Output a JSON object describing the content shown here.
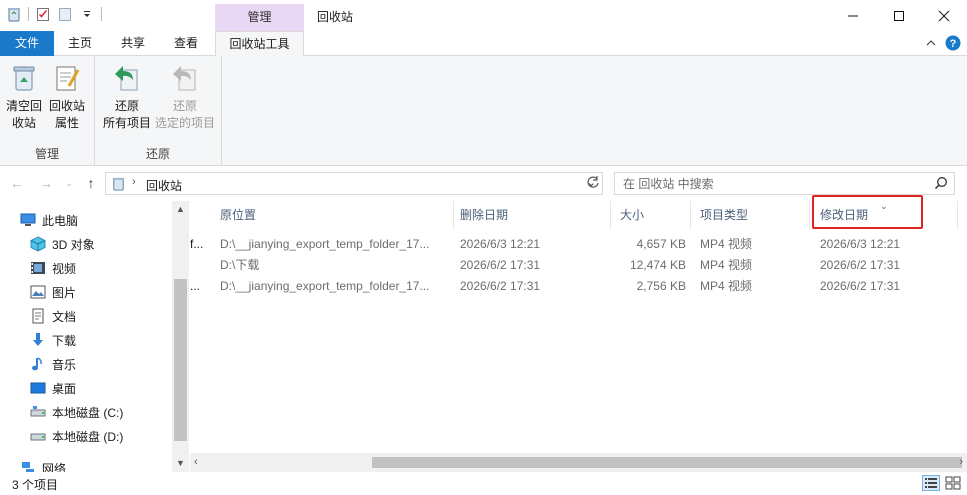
{
  "window": {
    "title": "回收站",
    "context_tab": "管理",
    "controls": [
      "minimize-icon",
      "maximize-icon",
      "close-icon"
    ]
  },
  "ribbon": {
    "tabs": [
      {
        "label": "文件",
        "name": "tab-file"
      },
      {
        "label": "主页",
        "name": "tab-home"
      },
      {
        "label": "共享",
        "name": "tab-share"
      },
      {
        "label": "查看",
        "name": "tab-view"
      },
      {
        "label": "回收站工具",
        "name": "tab-recycle-tools"
      }
    ],
    "groups": {
      "manage": {
        "label": "管理",
        "buttons": [
          {
            "line1": "清空回",
            "line2": "收站"
          },
          {
            "line1": "回收站",
            "line2": "属性"
          }
        ]
      },
      "restore": {
        "label": "还原",
        "buttons": [
          {
            "line1": "还原",
            "line2": "所有项目"
          },
          {
            "line1": "还原",
            "line2": "选定的项目"
          }
        ]
      }
    }
  },
  "address": {
    "path": "回收站",
    "search_placeholder": "在 回收站 中搜索"
  },
  "navpane": {
    "items": [
      {
        "label": "此电脑",
        "icon": "pc-icon"
      },
      {
        "label": "3D 对象",
        "icon": "3d-objects-icon"
      },
      {
        "label": "视频",
        "icon": "video-icon"
      },
      {
        "label": "图片",
        "icon": "pictures-icon"
      },
      {
        "label": "文档",
        "icon": "documents-icon"
      },
      {
        "label": "下载",
        "icon": "download-icon"
      },
      {
        "label": "音乐",
        "icon": "music-icon"
      },
      {
        "label": "桌面",
        "icon": "desktop-icon"
      },
      {
        "label": "本地磁盘 (C:)",
        "icon": "drive-icon"
      },
      {
        "label": "本地磁盘 (D:)",
        "icon": "drive-icon"
      },
      {
        "label": "网络",
        "icon": "network-icon"
      }
    ]
  },
  "list": {
    "columns": {
      "origin": "原位置",
      "deleted": "删除日期",
      "size": "大小",
      "type": "项目类型",
      "modified": "修改日期"
    },
    "rows": [
      {
        "name_clip": "f...",
        "origin": "D:\\__jianying_export_temp_folder_17...",
        "deleted": "2026/6/3 12:21",
        "size": "4,657 KB",
        "type": "MP4 视频",
        "modified": "2026/6/3 12:21"
      },
      {
        "name_clip": "",
        "origin": "D:\\下载",
        "deleted": "2026/6/2 17:31",
        "size": "12,474 KB",
        "type": "MP4 视频",
        "modified": "2026/6/2 17:31"
      },
      {
        "name_clip": "...",
        "origin": "D:\\__jianying_export_temp_folder_17...",
        "deleted": "2026/6/2 17:31",
        "size": "2,756 KB",
        "type": "MP4 视频",
        "modified": "2026/6/2 17:31"
      }
    ]
  },
  "status": {
    "count": "3 个项目"
  },
  "colors": {
    "file_tab": "#1979ca",
    "context_tab": "#e8d8f4",
    "header_text": "#4c607a",
    "highlight": "#e32222"
  }
}
